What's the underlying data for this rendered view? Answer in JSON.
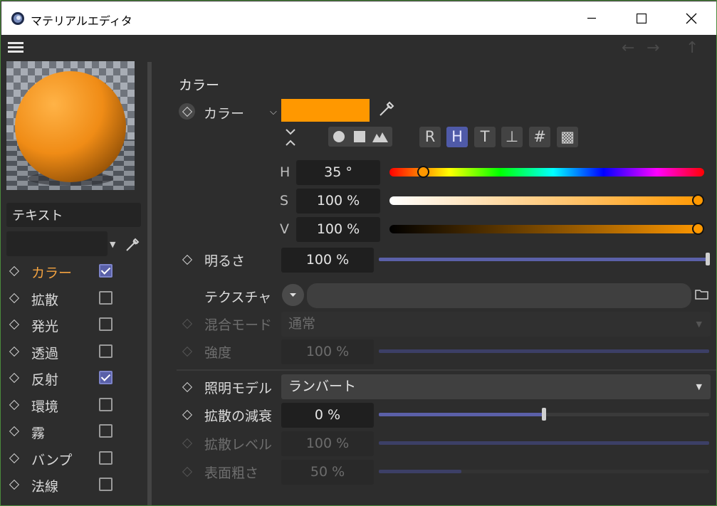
{
  "window": {
    "title": "マテリアルエディタ"
  },
  "channels": [
    {
      "label": "カラー",
      "checked": true,
      "active": true
    },
    {
      "label": "拡散",
      "checked": false,
      "active": false
    },
    {
      "label": "発光",
      "checked": false,
      "active": false
    },
    {
      "label": "透過",
      "checked": false,
      "active": false
    },
    {
      "label": "反射",
      "checked": true,
      "active": false
    },
    {
      "label": "環境",
      "checked": false,
      "active": false
    },
    {
      "label": "霧",
      "checked": false,
      "active": false
    },
    {
      "label": "バンプ",
      "checked": false,
      "active": false
    },
    {
      "label": "法線",
      "checked": false,
      "active": false
    }
  ],
  "material_name": "テキスト",
  "section": {
    "title": "カラー",
    "color_label": "カラー",
    "color_hex": "#ff9800",
    "modes": [
      "R",
      "H",
      "T",
      "⊥",
      "#",
      "▩"
    ],
    "active_mode": "H",
    "h_label": "H",
    "h_value": "35 °",
    "s_label": "S",
    "s_value": "100 %",
    "v_label": "V",
    "v_value": "100 %",
    "brightness_label": "明るさ",
    "brightness_value": "100 %",
    "brightness_level": 1.0,
    "texture_label": "テクスチャ",
    "blend_label": "混合モード",
    "blend_value": "通常",
    "strength_label": "強度",
    "strength_value": "100 %",
    "strength_level": 1.0,
    "lighting_label": "照明モデル",
    "lighting_value": "ランバート",
    "falloff_label": "拡散の減衰",
    "falloff_value": "0 %",
    "falloff_level": 0.5,
    "diffuse_label": "拡散レベル",
    "diffuse_value": "100 %",
    "diffuse_level": 1.0,
    "rough_label": "表面粗さ",
    "rough_value": "50 %",
    "rough_level": 0.25
  }
}
